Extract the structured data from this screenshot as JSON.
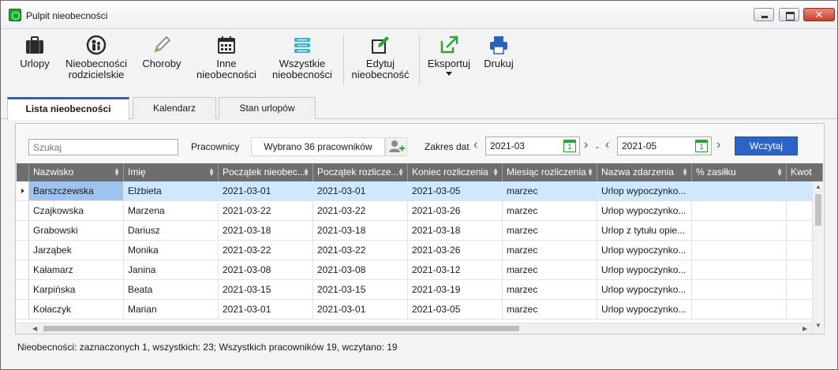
{
  "window": {
    "title": "Pulpit nieobecności"
  },
  "ribbon": {
    "urlopy": "Urlopy",
    "rodzicielskie_l1": "Nieobecności",
    "rodzicielskie_l2": "rodzicielskie",
    "choroby": "Choroby",
    "inne_l1": "Inne",
    "inne_l2": "nieobecności",
    "wszystkie_l1": "Wszystkie",
    "wszystkie_l2": "nieobecności",
    "edytuj_l1": "Edytuj",
    "edytuj_l2": "nieobecność",
    "eksportuj": "Eksportuj",
    "drukuj": "Drukuj"
  },
  "tabs": {
    "lista": "Lista nieobecności",
    "kalendarz": "Kalendarz",
    "stan": "Stan urlopów"
  },
  "filter": {
    "search_placeholder": "Szukaj",
    "employees_label": "Pracownicy",
    "employees_value": "Wybrano 36 pracowników",
    "date_range_label": "Zakres dat",
    "date_from": "2021-03",
    "date_separator": "-",
    "date_to": "2021-05",
    "calendar_day": "1",
    "load_label": "Wczytaj"
  },
  "grid": {
    "columns": [
      "Nazwisko",
      "Imię",
      "Początek nieobec...",
      "Początek rozlicze...",
      "Koniec rozliczenia",
      "Miesiąc rozliczenia",
      "Nazwa zdarzenia",
      "% zasiłku",
      "Kwot"
    ],
    "rows": [
      [
        "Barszczewska",
        "Elżbieta",
        "2021-03-01",
        "2021-03-01",
        "2021-03-05",
        "marzec",
        "Urlop wypoczynko...",
        "",
        ""
      ],
      [
        "Czajkowska",
        "Marzena",
        "2021-03-22",
        "2021-03-22",
        "2021-03-26",
        "marzec",
        "Urlop wypoczynko...",
        "",
        ""
      ],
      [
        "Grabowski",
        "Dariusz",
        "2021-03-18",
        "2021-03-18",
        "2021-03-18",
        "marzec",
        "Urlop z tytułu opie...",
        "",
        ""
      ],
      [
        "Jarząbek",
        "Monika",
        "2021-03-22",
        "2021-03-22",
        "2021-03-26",
        "marzec",
        "Urlop wypoczynko...",
        "",
        ""
      ],
      [
        "Kałamarz",
        "Janina",
        "2021-03-08",
        "2021-03-08",
        "2021-03-12",
        "marzec",
        "Urlop wypoczynko...",
        "",
        ""
      ],
      [
        "Karpińska",
        "Beata",
        "2021-03-15",
        "2021-03-15",
        "2021-03-19",
        "marzec",
        "Urlop wypoczynko...",
        "",
        ""
      ],
      [
        "Kołaczyk",
        "Marian",
        "2021-03-01",
        "2021-03-01",
        "2021-03-05",
        "marzec",
        "Urlop wypoczynko...",
        "",
        ""
      ]
    ]
  },
  "status": "Nieobecności: zaznaczonych 1, wszystkich: 23;  Wszystkich pracowników 19, wczytano: 19",
  "colors": {
    "accent": "#2c63c9",
    "selected_row": "#cde8ff",
    "header_bg": "#6e6e6e"
  }
}
